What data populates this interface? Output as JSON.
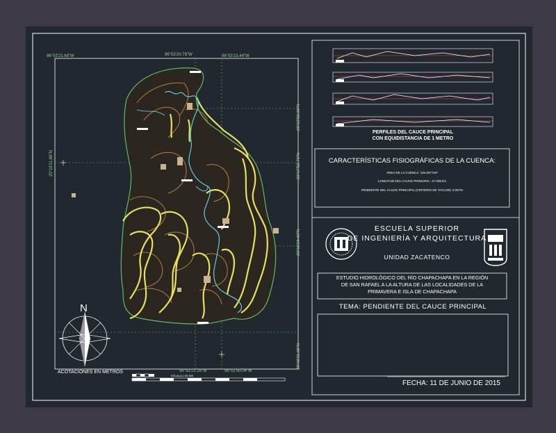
{
  "map": {
    "coords_top": [
      "96°53'21.68\"W",
      "96°53'20.78\"W",
      "96°53'15.44\"W"
    ],
    "coords_bottom": [
      "96°53'22.16\"W",
      "96°51'50.04\"W"
    ],
    "coords_left": [
      "20°19'11.66\"N"
    ],
    "coords_right": [
      "20°19'02.38\"N",
      "20°17'52.70\"N",
      "20°16'24.40\"N",
      "20°15'11.36\"N"
    ],
    "north_label": "N",
    "acotaciones": "ACOTACIONES EN METROS",
    "scale_label": "ESCALA 1:50,000"
  },
  "profiles": {
    "title_line1": "PERFILES DEL CAUCE PRINCIPAL",
    "title_line2": "CON EQUIDISTANCIA DE 1 METRO"
  },
  "characteristics": {
    "title": "CARACTERÍSTICAS FISIOGRÁFICAS DE LA CUENCA:",
    "area": "ÁREA DE LA CUENCA:  104.057 km²",
    "length": "LONGITUD DEL CAUCE PRINCIPAL: 27.038 km",
    "slope": "PENDIENTE DEL CAUCE PRINCIPAL (CRITERIO DE TAYLOR): 0.057%"
  },
  "institution": {
    "line1": "ESCUELA SUPERIOR",
    "line2": "DE INGENIERÍA Y ARQUITECTURA",
    "unit": "UNIDAD ZACATENCO"
  },
  "study": {
    "line1": "ESTUDIO HIDROLÓGICO DEL RÍO CHAPACHAPA EN LA REGIÓN",
    "line2": "DE SAN RAFAEL A LA ALTURA DE LAS LOCALIDADES DE LA",
    "line3": "PRIMAVERA E ISLA DE CHAPACHAPA"
  },
  "tema": "TEMA: PENDIENTE DEL CAUCE PRINCIPAL",
  "fecha": "FECHA: 11 DE JUNIO DE 2015",
  "colors": {
    "sheet": "#212830",
    "background": "#3d3a45",
    "contour_major": "#e8e060",
    "contour_minor": "#a9783a",
    "river": "#5fd0e0",
    "boundary": "#5fbf5f",
    "profile_red": "#d03030",
    "coord_text": "#8fd18f"
  }
}
